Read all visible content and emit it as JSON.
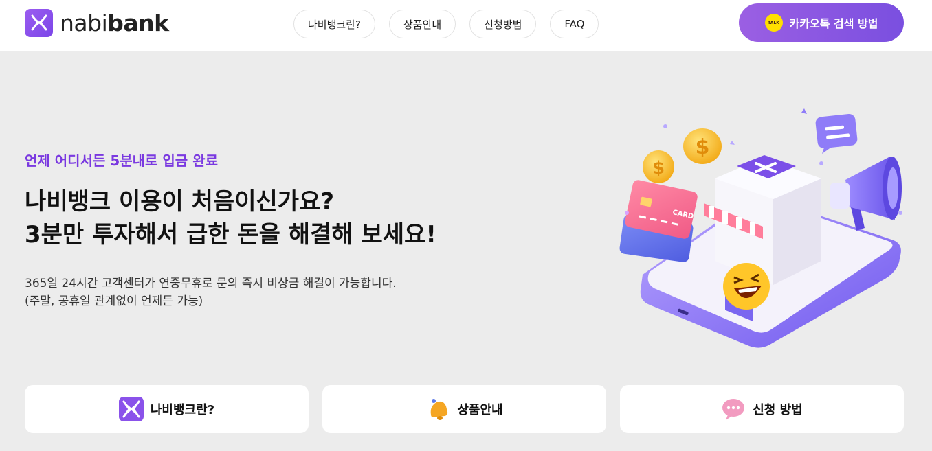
{
  "brand": {
    "name_light": "nabi",
    "name_bold": "bank",
    "accent": "#7b46e8",
    "logo_icon": "nabibank-logo-icon"
  },
  "nav": {
    "items": [
      {
        "label": "나비뱅크란?"
      },
      {
        "label": "상품안내"
      },
      {
        "label": "신청방법"
      },
      {
        "label": "FAQ"
      }
    ]
  },
  "kakao_button": {
    "label": "카카오톡 검색 방법",
    "icon": "kakaotalk-icon",
    "icon_text": "TALK",
    "color": "#8a55e2"
  },
  "hero": {
    "subtitle": "언제 어디서든 5분내로 입금 완료",
    "title_line1": "나비뱅크 이용이 처음이신가요?",
    "title_line2": "3분만 투자해서 급한 돈을 해결해 보세요!",
    "desc_line1": "365일 24시간 고객센터가 연중무휴로 문의 즉시 비상금 해결이 가능합니다.",
    "desc_line2": "(주말, 공휴일 관계없이 언제든 가능)",
    "illustration": {
      "card_text": "CARD",
      "icons": [
        "smartphone-icon",
        "store-icon",
        "coin-icon",
        "credit-card-icon",
        "megaphone-icon",
        "chat-bubble-icon",
        "laughing-emoji-icon"
      ]
    }
  },
  "cards": [
    {
      "label": "나비뱅크란?",
      "icon": "nabibank-logo-icon"
    },
    {
      "label": "상품안내",
      "icon": "bell-icon"
    },
    {
      "label": "신청 방법",
      "icon": "chat-bubble-icon"
    }
  ]
}
